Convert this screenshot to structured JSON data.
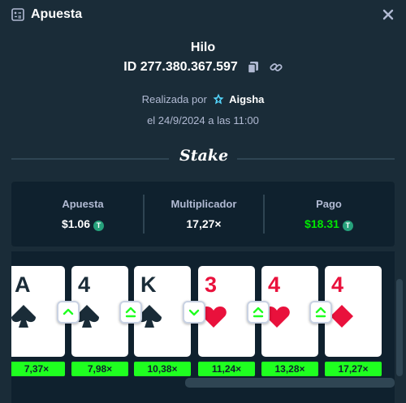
{
  "header": {
    "title": "Apuesta",
    "icon": "receipt-icon",
    "close_icon": "close-icon"
  },
  "bet": {
    "game": "Hilo",
    "id": "ID 277.380.367.597",
    "placed_by_prefix": "Realizada por",
    "user": "Aigsha",
    "date": "el 24/9/2024 a las 11:00"
  },
  "logo_text": "Stake",
  "summary": [
    {
      "label": "Apuesta",
      "value": "$1.06",
      "currency": "T",
      "color": "#ffffff"
    },
    {
      "label": "Multiplicador",
      "value": "17,27×",
      "color": "#ffffff"
    },
    {
      "label": "Pago",
      "value": "$18.31",
      "currency": "T",
      "color": "#00e701"
    }
  ],
  "cards": [
    {
      "rank": "A",
      "suit": "spade",
      "color": "black",
      "multiplier": "7,37×"
    },
    {
      "rank": "4",
      "suit": "spade",
      "color": "black",
      "multiplier": "7,98×",
      "guess": "higher"
    },
    {
      "rank": "K",
      "suit": "spade",
      "color": "black",
      "multiplier": "10,38×",
      "guess": "higher-or-equal"
    },
    {
      "rank": "3",
      "suit": "heart",
      "color": "red",
      "multiplier": "11,24×",
      "guess": "lower"
    },
    {
      "rank": "4",
      "suit": "heart",
      "color": "red",
      "multiplier": "13,28×",
      "guess": "higher-or-equal"
    },
    {
      "rank": "4",
      "suit": "diamond",
      "color": "red",
      "multiplier": "17,27×",
      "guess": "higher-or-equal"
    }
  ],
  "colors": {
    "background": "#1a2c38",
    "panel": "#0f212e",
    "accent_green": "#1fff20",
    "payout_green": "#00e701",
    "card_red": "#e9113c",
    "tether": "#26a17b"
  }
}
